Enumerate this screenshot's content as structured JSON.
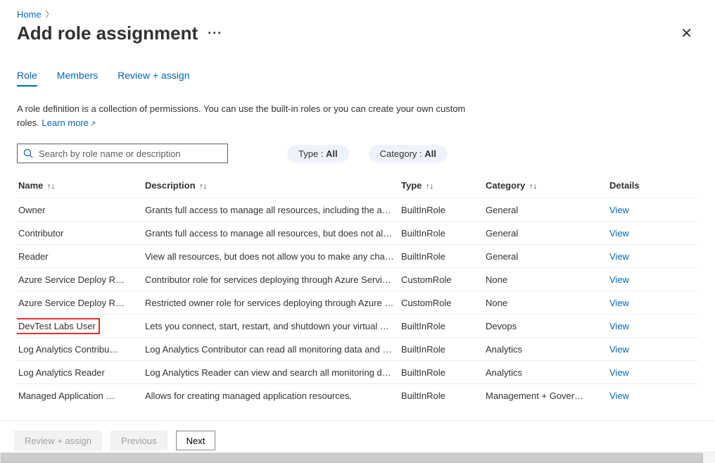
{
  "breadcrumb": {
    "home": "Home"
  },
  "page": {
    "title": "Add role assignment"
  },
  "tabs": {
    "role": "Role",
    "members": "Members",
    "review": "Review + assign"
  },
  "description": {
    "text": "A role definition is a collection of permissions. You can use the built-in roles or you can create your own custom roles.",
    "learn_more": "Learn more"
  },
  "search": {
    "placeholder": "Search by role name or description"
  },
  "filters": {
    "type_label": "Type : ",
    "type_value": "All",
    "category_label": "Category : ",
    "category_value": "All"
  },
  "columns": {
    "name": "Name",
    "description": "Description",
    "type": "Type",
    "category": "Category",
    "details": "Details"
  },
  "view_label": "View",
  "rows": [
    {
      "name": "Owner",
      "desc": "Grants full access to manage all resources, including the abili…",
      "type": "BuiltInRole",
      "category": "General",
      "highlight": false
    },
    {
      "name": "Contributor",
      "desc": "Grants full access to manage all resources, but does not allo…",
      "type": "BuiltInRole",
      "category": "General",
      "highlight": false
    },
    {
      "name": "Reader",
      "desc": "View all resources, but does not allow you to make any chan…",
      "type": "BuiltInRole",
      "category": "General",
      "highlight": false
    },
    {
      "name": "Azure Service Deploy R…",
      "desc": "Contributor role for services deploying through Azure Servic…",
      "type": "CustomRole",
      "category": "None",
      "highlight": false
    },
    {
      "name": "Azure Service Deploy R…",
      "desc": "Restricted owner role for services deploying through Azure S…",
      "type": "CustomRole",
      "category": "None",
      "highlight": false
    },
    {
      "name": "DevTest Labs User",
      "desc": "Lets you connect, start, restart, and shutdown your virtual m…",
      "type": "BuiltInRole",
      "category": "Devops",
      "highlight": true
    },
    {
      "name": "Log Analytics Contribu…",
      "desc": "Log Analytics Contributor can read all monitoring data and e…",
      "type": "BuiltInRole",
      "category": "Analytics",
      "highlight": false
    },
    {
      "name": "Log Analytics Reader",
      "desc": "Log Analytics Reader can view and search all monitoring dat…",
      "type": "BuiltInRole",
      "category": "Analytics",
      "highlight": false
    },
    {
      "name": "Managed Application …",
      "desc": "Allows for creating managed application resources.",
      "type": "BuiltInRole",
      "category": "Management + Gover…",
      "highlight": false
    }
  ],
  "footer": {
    "review": "Review + assign",
    "previous": "Previous",
    "next": "Next"
  }
}
